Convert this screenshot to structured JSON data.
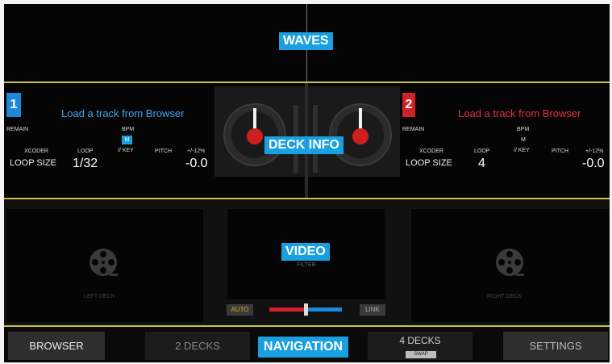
{
  "callouts": {
    "waves": "WAVES",
    "deck_info": "DECK INFO",
    "video": "VIDEO",
    "navigation": "NAVIGATION"
  },
  "deck1": {
    "number": "1",
    "load_text": "Load a track from Browser",
    "remain": "REMAIN",
    "bpm": "BPM",
    "m": "M",
    "key": "// KEY",
    "xcoder": "XCODER",
    "loop": "LOOP",
    "pitch": "PITCH",
    "pitch_range": "+/-12%",
    "loop_size_label": "LOOP SIZE",
    "loop_size_value": "1/32",
    "pitch_value": "-0.0",
    "color": "#1e88d8"
  },
  "deck2": {
    "number": "2",
    "load_text": "Load a track from Browser",
    "remain": "REMAIN",
    "bpm": "BPM",
    "m": "M",
    "key": "// KEY",
    "xcoder": "XCODER",
    "loop": "LOOP",
    "pitch": "PITCH",
    "pitch_range": "+/-12%",
    "loop_size_label": "LOOP SIZE",
    "loop_size_value": "4",
    "pitch_value": "-0.0",
    "color": "#d0202a"
  },
  "video": {
    "left_deck": "LEFT DECK",
    "right_deck": "RIGHT DECK",
    "preview_text": "FILTER",
    "auto": "AUTO",
    "link": "LINK",
    "crossfader_position": 0.5
  },
  "nav": {
    "browser": "BROWSER",
    "two_decks": "2 DECKS",
    "four_decks": "4 DECKS",
    "swap": "SWAP",
    "settings": "SETTINGS"
  },
  "colors": {
    "accent": "#1aa0e0",
    "border": "#c9c34a"
  }
}
